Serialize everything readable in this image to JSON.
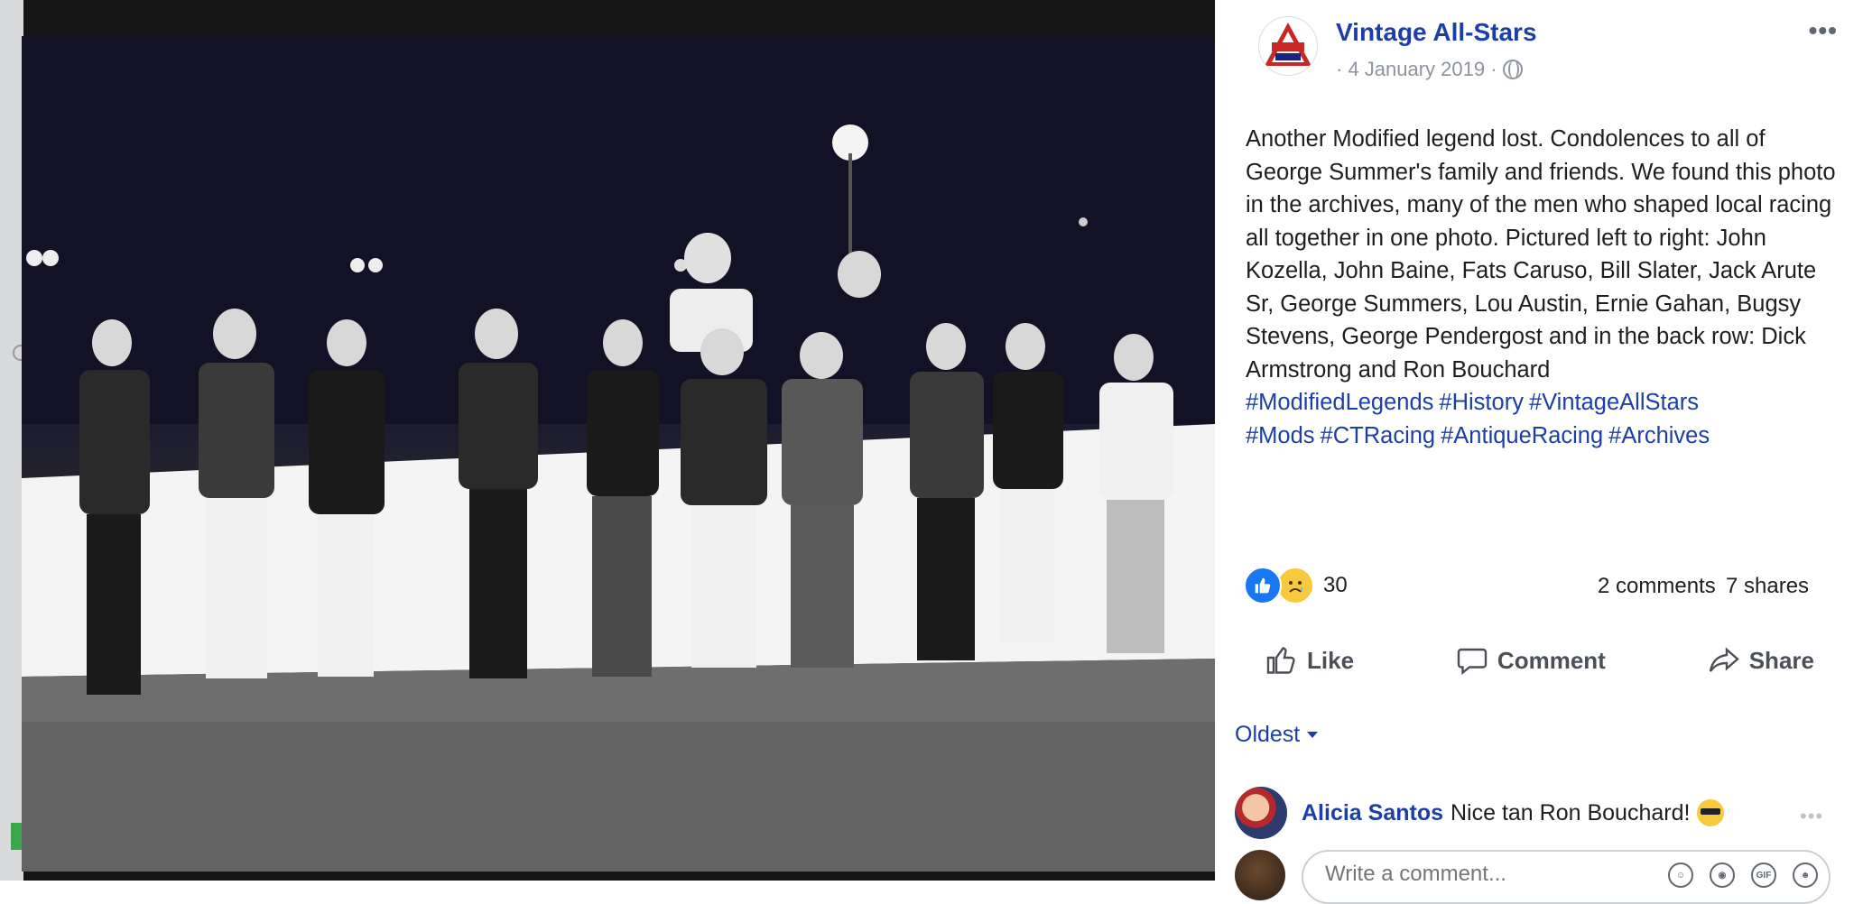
{
  "post": {
    "page_name": "Vintage All-Stars",
    "date": "· 4 January 2019 ·",
    "privacy_icon": "globe-icon",
    "more_label": "•••",
    "text": "Another Modified legend lost. Condolences to all of George Summer's family and friends. We found this photo in the archives, many of the men who shaped local racing all together in one photo. Pictured left to right: John Kozella, John Baine, Fats Caruso, Bill Slater, Jack Arute Sr, George Summers, Lou Austin, Ernie Gahan, Bugsy Stevens, George Pendergost and in the back row: Dick Armstrong and Ron Bouchard",
    "hashtags": [
      "#ModifiedLegends",
      "#History",
      "#VintageAllStars",
      "#Mods",
      "#CTRacing",
      "#AntiqueRacing",
      "#Archives"
    ],
    "avatar_logo_text": "VINTAGE ALL-STARS"
  },
  "stats": {
    "reaction_count": "30",
    "reaction_icons": [
      "like-icon",
      "sad-icon"
    ],
    "comments": "2 comments",
    "shares": "7 shares"
  },
  "actions": {
    "like": "Like",
    "comment": "Comment",
    "share": "Share"
  },
  "comments_section": {
    "sort_label": "Oldest",
    "items": [
      {
        "author": "Alicia Santos",
        "text": "Nice tan Ron Bouchard!",
        "emoji": "sunglasses-emoji"
      }
    ],
    "compose_placeholder": "Write a comment...",
    "compose_icons": [
      "emoji-icon",
      "camera-icon",
      "gif-icon",
      "sticker-icon"
    ]
  },
  "colors": {
    "link": "#1d3ea6",
    "like_blue": "#1877f2",
    "muted": "#8d949e"
  }
}
